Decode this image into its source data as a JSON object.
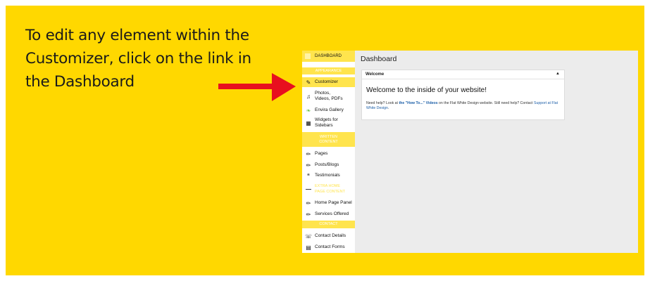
{
  "caption": "To edit any element within the Customizer, click on the link in the Dashboard",
  "colors": {
    "background": "#ffd800",
    "arrow": "#e8101e",
    "accent": "#ffe44d"
  },
  "screenshot": {
    "sidebar": {
      "top_item": {
        "icon": "dashboard-icon",
        "label": "DASHBOARD"
      },
      "sections": [
        {
          "heading": "APPEARANCE"
        },
        {
          "heading": "WRITTEN CONTENT"
        },
        {
          "heading": "CONTACT"
        }
      ],
      "items": [
        {
          "icon": "brush-icon",
          "label": "Customizer"
        },
        {
          "icon": "media-icon",
          "label": "Photos, Videos, PDFs"
        },
        {
          "icon": "leaf-icon",
          "label": "Envira Gallery"
        },
        {
          "icon": "widgets-icon",
          "label": "Widgets for Sidebars"
        },
        {
          "icon": "pencil-icon",
          "label": "Pages"
        },
        {
          "icon": "pencil-icon",
          "label": "Posts/Blogs"
        },
        {
          "icon": "quote-icon",
          "label": "Testimonials"
        },
        {
          "icon": "dash-icon",
          "label": "EXTRA HOME PAGE CONTENT"
        },
        {
          "icon": "pencil-icon",
          "label": "Home Page Panel"
        },
        {
          "icon": "pencil-icon",
          "label": "Services Offered"
        },
        {
          "icon": "phone-icon",
          "label": "Contact Details"
        },
        {
          "icon": "form-icon",
          "label": "Contact Forms"
        }
      ]
    },
    "main": {
      "title": "Dashboard",
      "panel": {
        "header": "Welcome",
        "heading": "Welcome to the inside of your website!",
        "text_1": "Need help? Look at ",
        "link_1": "the \"How To...\" Videos",
        "text_2": " on the Flat White Design website. Still need help? Contact ",
        "link_2": "Support at Flat White Design",
        "text_3": "."
      }
    }
  }
}
